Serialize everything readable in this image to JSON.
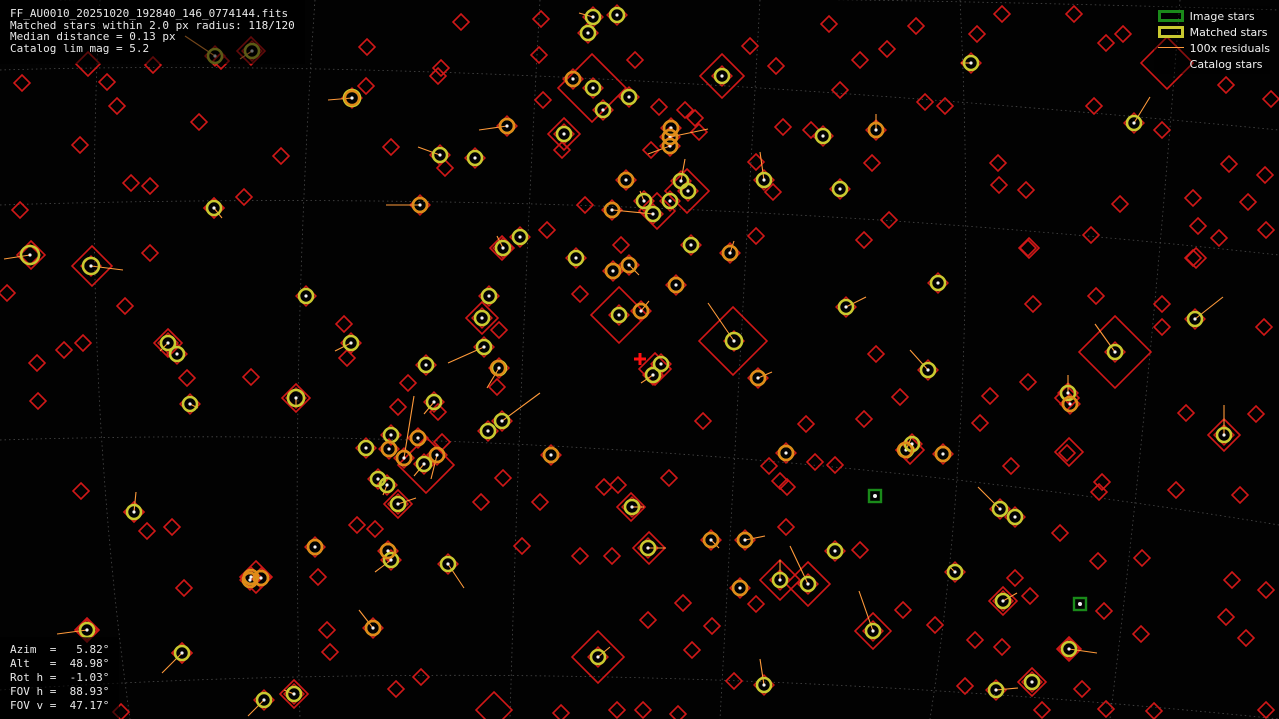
{
  "header": {
    "filename": "FF_AU0010_20251020_192840_146_0774144.fits",
    "matched_line": "Matched stars within 2.0 px radius: 118/120",
    "median_line": "Median distance = 0.13 px",
    "limmag_line": "Catalog lim mag = 5.2"
  },
  "legend": {
    "image_stars": "Image stars",
    "matched_stars": "Matched stars",
    "residuals": "100x residuals",
    "catalog_stars": "Catalog stars"
  },
  "pointing": {
    "azim": "Azim  =   5.82°",
    "alt": "Alt   =  48.98°",
    "roth": "Rot h =  -1.03°",
    "fovh": "FOV h =  88.93°",
    "fovv": "FOV v =  47.17°"
  },
  "colors": {
    "catalog": "#d01818",
    "matched": "#c9c930",
    "image": "#1a8a1a",
    "residual": "#ff9a3a",
    "grid": "#6a6a6a",
    "center_cross": "#ff1010"
  },
  "icons": {
    "center_marker": "red-cross-icon"
  }
}
